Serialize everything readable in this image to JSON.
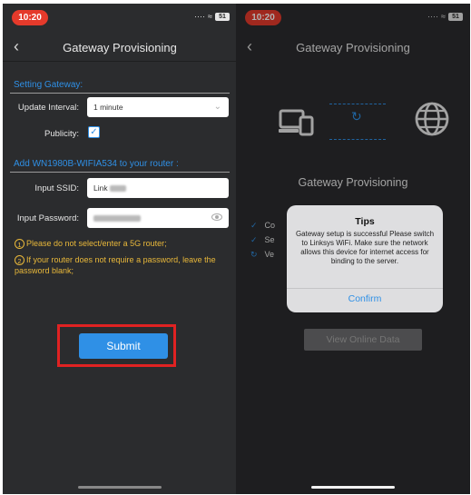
{
  "left": {
    "status": {
      "time": "10:20",
      "battery": "51"
    },
    "nav": {
      "title": "Gateway Provisioning",
      "back_icon": "chevron-left-icon"
    },
    "setting_section": "Setting Gateway:",
    "update_interval": {
      "label": "Update Interval:",
      "value": "1 minute"
    },
    "publicity": {
      "label": "Publicity:",
      "checked": true
    },
    "add_section": "Add WN1980B-WIFIA534 to your router :",
    "ssid": {
      "label": "Input SSID:",
      "value": "Link"
    },
    "password": {
      "label": "Input Password:"
    },
    "notes": [
      {
        "num": "1",
        "text": "Please do not select/enter a 5G router;"
      },
      {
        "num": "2",
        "text": "If your router does not require a password, leave the password blank;"
      }
    ],
    "submit_label": "Submit"
  },
  "right": {
    "status": {
      "time": "10:20",
      "battery": "51"
    },
    "nav": {
      "title": "Gateway Provisioning"
    },
    "title": "Gateway Provisioning",
    "steps": [
      {
        "icon": "✓",
        "text": "Co"
      },
      {
        "icon": "✓",
        "text": "Se"
      },
      {
        "icon": "↻",
        "text": "Ve"
      }
    ],
    "view_button": "View Online Data",
    "dialog": {
      "title": "Tips",
      "message": "Gateway setup is successful Please switch to Linksys WiFi. Make sure the network allows this device for internet access for binding to the server.",
      "confirm": "Confirm"
    }
  },
  "colors": {
    "accent": "#2f90e6",
    "warning": "#e9b83a",
    "highlight": "#e02222",
    "background": "#2b2c2e"
  }
}
